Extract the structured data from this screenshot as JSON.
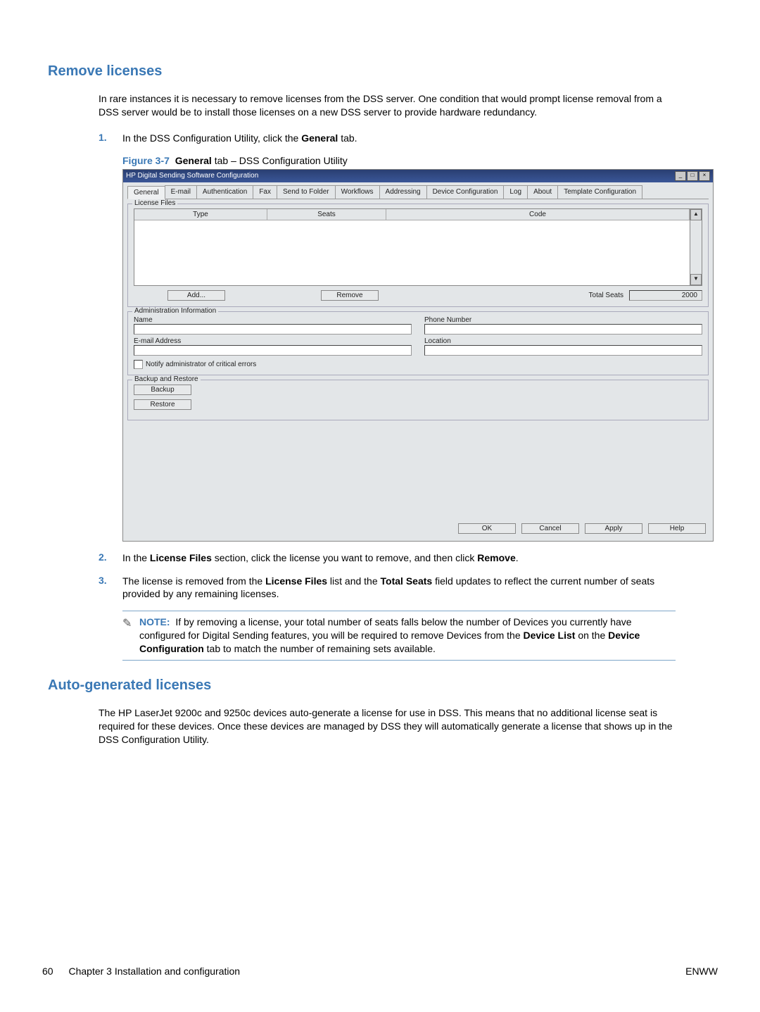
{
  "section1": {
    "title": "Remove licenses",
    "intro": "In rare instances it is necessary to remove licenses from the DSS server. One condition that would prompt license removal from a DSS server would be to install those licenses on a new DSS server to provide hardware redundancy.",
    "step1_pre": "In the DSS Configuration Utility, click the ",
    "step1_bold": "General",
    "step1_post": " tab.",
    "fig_label": "Figure 3-7",
    "fig_bold": "General",
    "fig_rest": " tab – DSS Configuration Utility",
    "step2_pre": "In the ",
    "step2_b1": "License Files",
    "step2_mid": " section, click the license you want to remove, and then click ",
    "step2_b2": "Remove",
    "step2_post": ".",
    "step3_pre": "The license is removed from the ",
    "step3_b1": "License Files",
    "step3_mid1": " list and the ",
    "step3_b2": "Total Seats",
    "step3_mid2": " field updates to reflect the current number of seats provided by any remaining licenses."
  },
  "note": {
    "label": "NOTE:",
    "pre": "If by removing a license, your total number of seats falls below the number of Devices you currently have configured for Digital Sending features, you will be required to remove Devices from the ",
    "b1": "Device List",
    "mid": " on the ",
    "b2": "Device Configuration",
    "post": " tab to match the number of remaining sets available."
  },
  "section2": {
    "title": "Auto-generated licenses",
    "para": "The HP LaserJet 9200c and 9250c devices auto-generate a license for use in DSS. This means that no additional license seat is required for these devices. Once these devices are managed by DSS they will automatically generate a license that shows up in the DSS Configuration Utility."
  },
  "screenshot": {
    "title": "HP Digital Sending Software Configuration",
    "tabs": [
      "General",
      "E-mail",
      "Authentication",
      "Fax",
      "Send to Folder",
      "Workflows",
      "Addressing",
      "Device Configuration",
      "Log",
      "About",
      "Template Configuration"
    ],
    "license_group": "License Files",
    "cols": {
      "type": "Type",
      "seats": "Seats",
      "code": "Code"
    },
    "add": "Add...",
    "remove": "Remove",
    "total_seats_label": "Total Seats",
    "total_seats_value": "2000",
    "admin_group": "Administration Information",
    "name": "Name",
    "phone": "Phone Number",
    "email": "E-mail Address",
    "location": "Location",
    "notify": "Notify administrator of critical errors",
    "backup_group": "Backup and Restore",
    "backup": "Backup",
    "restore": "Restore",
    "ok": "OK",
    "cancel": "Cancel",
    "apply": "Apply",
    "help": "Help"
  },
  "nums": {
    "n1": "1.",
    "n2": "2.",
    "n3": "3."
  },
  "footer": {
    "page_no": "60",
    "chapter": "Chapter 3   Installation and configuration",
    "right": "ENWW"
  }
}
